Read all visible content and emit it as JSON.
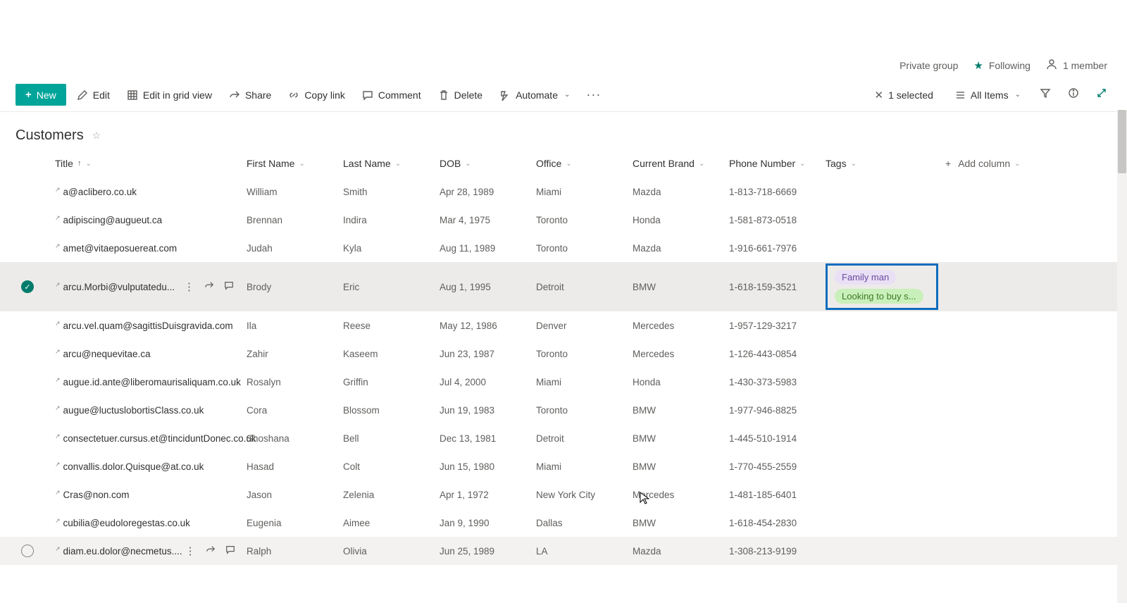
{
  "topbar": {
    "private_group": "Private group",
    "following": "Following",
    "members": "1 member"
  },
  "commands": {
    "new": "New",
    "edit": "Edit",
    "edit_grid": "Edit in grid view",
    "share": "Share",
    "copy_link": "Copy link",
    "comment": "Comment",
    "delete": "Delete",
    "automate": "Automate",
    "selected": "1 selected",
    "all_items": "All Items"
  },
  "list": {
    "title": "Customers"
  },
  "columns": {
    "title": "Title",
    "first": "First Name",
    "last": "Last Name",
    "dob": "DOB",
    "office": "Office",
    "brand": "Current Brand",
    "phone": "Phone Number",
    "tags": "Tags",
    "add": "Add column"
  },
  "rows": [
    {
      "title": "a@aclibero.co.uk",
      "first": "William",
      "last": "Smith",
      "dob": "Apr 28, 1989",
      "office": "Miami",
      "brand": "Mazda",
      "phone": "1-813-718-6669",
      "tags": [],
      "state": "normal"
    },
    {
      "title": "adipiscing@augueut.ca",
      "first": "Brennan",
      "last": "Indira",
      "dob": "Mar 4, 1975",
      "office": "Toronto",
      "brand": "Honda",
      "phone": "1-581-873-0518",
      "tags": [],
      "state": "normal"
    },
    {
      "title": "amet@vitaeposuereat.com",
      "first": "Judah",
      "last": "Kyla",
      "dob": "Aug 11, 1989",
      "office": "Toronto",
      "brand": "Mazda",
      "phone": "1-916-661-7976",
      "tags": [],
      "state": "normal"
    },
    {
      "title": "arcu.Morbi@vulputatedu...",
      "first": "Brody",
      "last": "Eric",
      "dob": "Aug 1, 1995",
      "office": "Detroit",
      "brand": "BMW",
      "phone": "1-618-159-3521",
      "tags": [
        {
          "text": "Family man",
          "cls": "purple"
        },
        {
          "text": "Looking to buy s...",
          "cls": "green"
        }
      ],
      "state": "selected"
    },
    {
      "title": "arcu.vel.quam@sagittisDuisgravida.com",
      "first": "Ila",
      "last": "Reese",
      "dob": "May 12, 1986",
      "office": "Denver",
      "brand": "Mercedes",
      "phone": "1-957-129-3217",
      "tags": [],
      "state": "normal"
    },
    {
      "title": "arcu@nequevitae.ca",
      "first": "Zahir",
      "last": "Kaseem",
      "dob": "Jun 23, 1987",
      "office": "Toronto",
      "brand": "Mercedes",
      "phone": "1-126-443-0854",
      "tags": [],
      "state": "normal"
    },
    {
      "title": "augue.id.ante@liberomaurisaliquam.co.uk",
      "first": "Rosalyn",
      "last": "Griffin",
      "dob": "Jul 4, 2000",
      "office": "Miami",
      "brand": "Honda",
      "phone": "1-430-373-5983",
      "tags": [],
      "state": "normal"
    },
    {
      "title": "augue@luctuslobortisClass.co.uk",
      "first": "Cora",
      "last": "Blossom",
      "dob": "Jun 19, 1983",
      "office": "Toronto",
      "brand": "BMW",
      "phone": "1-977-946-8825",
      "tags": [],
      "state": "normal"
    },
    {
      "title": "consectetuer.cursus.et@tinciduntDonec.co.uk",
      "first": "Shoshana",
      "last": "Bell",
      "dob": "Dec 13, 1981",
      "office": "Detroit",
      "brand": "BMW",
      "phone": "1-445-510-1914",
      "tags": [],
      "state": "normal"
    },
    {
      "title": "convallis.dolor.Quisque@at.co.uk",
      "first": "Hasad",
      "last": "Colt",
      "dob": "Jun 15, 1980",
      "office": "Miami",
      "brand": "BMW",
      "phone": "1-770-455-2559",
      "tags": [],
      "state": "normal"
    },
    {
      "title": "Cras@non.com",
      "first": "Jason",
      "last": "Zelenia",
      "dob": "Apr 1, 1972",
      "office": "New York City",
      "brand": "Mercedes",
      "phone": "1-481-185-6401",
      "tags": [],
      "state": "normal"
    },
    {
      "title": "cubilia@eudoloregestas.co.uk",
      "first": "Eugenia",
      "last": "Aimee",
      "dob": "Jan 9, 1990",
      "office": "Dallas",
      "brand": "BMW",
      "phone": "1-618-454-2830",
      "tags": [],
      "state": "normal"
    },
    {
      "title": "diam.eu.dolor@necmetus....",
      "first": "Ralph",
      "last": "Olivia",
      "dob": "Jun 25, 1989",
      "office": "LA",
      "brand": "Mazda",
      "phone": "1-308-213-9199",
      "tags": [],
      "state": "hovered"
    }
  ]
}
